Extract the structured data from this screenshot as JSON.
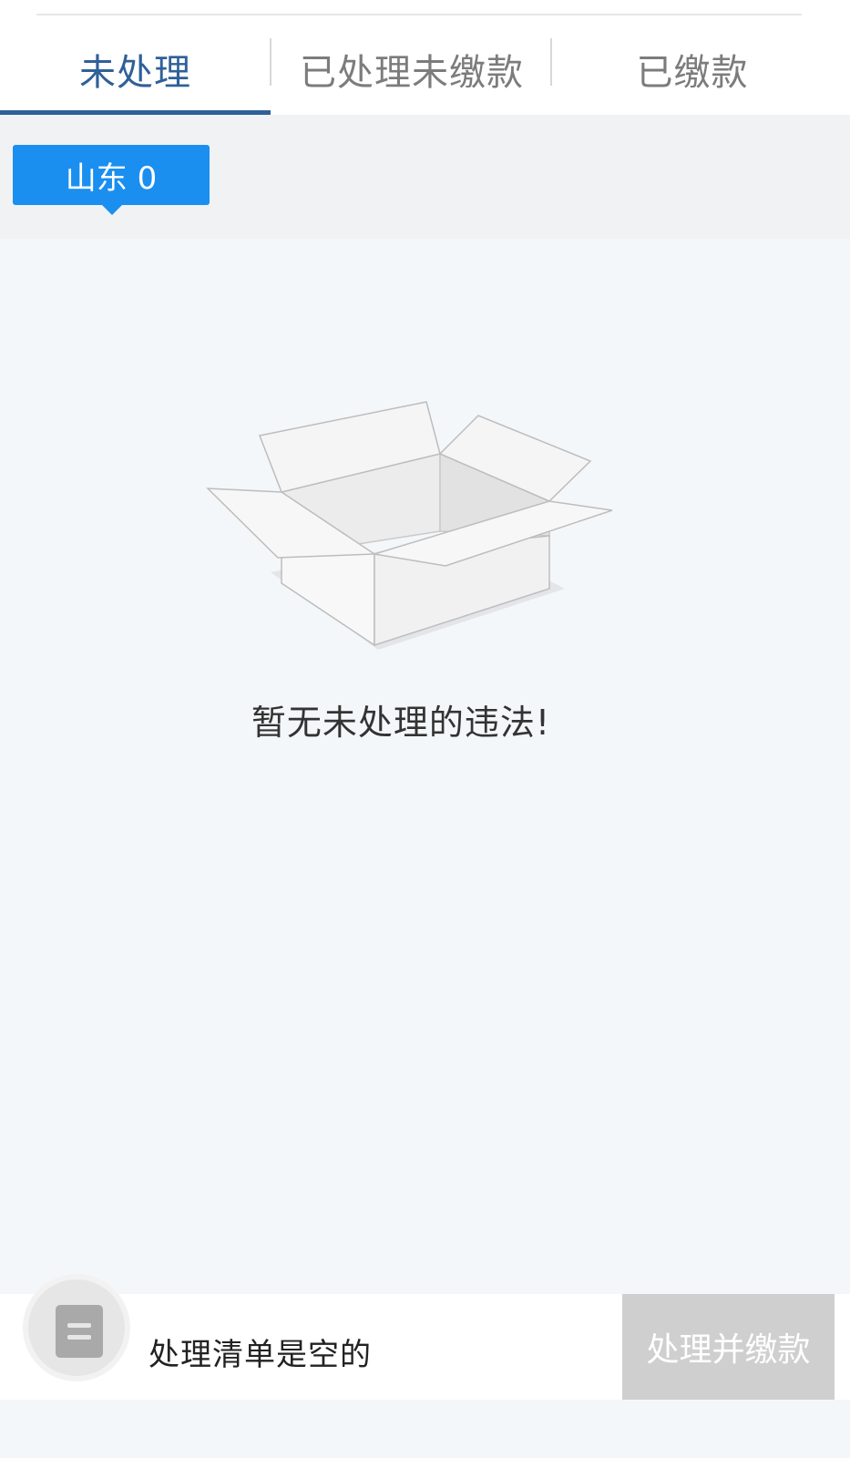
{
  "tabs": [
    {
      "label": "未处理",
      "active": true
    },
    {
      "label": "已处理未缴款",
      "active": false
    },
    {
      "label": "已缴款",
      "active": false
    }
  ],
  "region_filter": {
    "label": "山东 0"
  },
  "empty_state": {
    "icon": "open-box-icon",
    "message": "暂无未处理的违法!"
  },
  "bottom_bar": {
    "cart_icon": "list-icon",
    "status_text": "处理清单是空的",
    "action_label": "处理并缴款"
  },
  "colors": {
    "accent": "#2f6098",
    "chip": "#1b8ff0",
    "disabled_button": "#cfcfcf",
    "background": "#f4f7f9"
  }
}
